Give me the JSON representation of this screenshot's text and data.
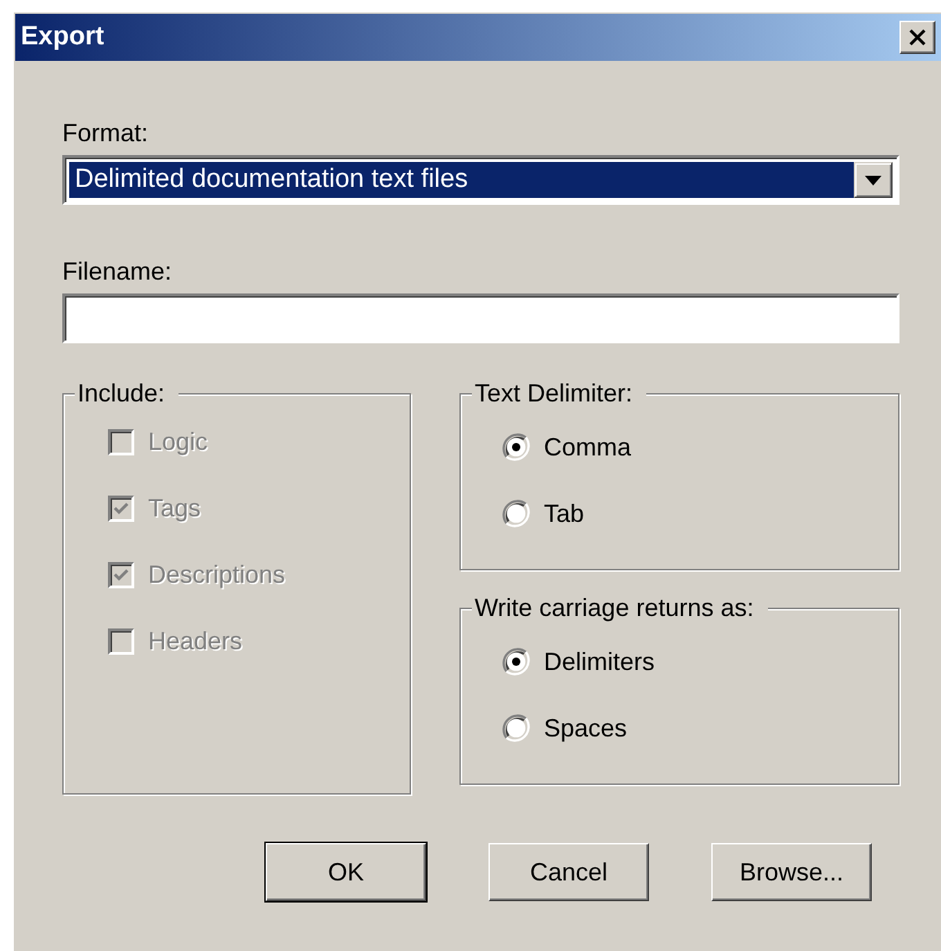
{
  "window": {
    "title": "Export"
  },
  "format": {
    "label": "Format:",
    "value": "Delimited documentation text files",
    "focused": true
  },
  "filename": {
    "label": "Filename:"
  },
  "include": {
    "title": "Include:",
    "items": [
      {
        "label": "Logic",
        "checked": false,
        "disabled": true
      },
      {
        "label": "Tags",
        "checked": true,
        "disabled": true
      },
      {
        "label": "Descriptions",
        "checked": true,
        "disabled": true
      },
      {
        "label": "Headers",
        "checked": false,
        "disabled": true
      }
    ]
  },
  "text_delimiter": {
    "title": "Text Delimiter:",
    "options": [
      {
        "label": "Comma",
        "selected": true
      },
      {
        "label": "Tab",
        "selected": false
      }
    ]
  },
  "carriage_returns": {
    "title": "Write carriage returns as:",
    "options": [
      {
        "label": "Delimiters",
        "selected": true
      },
      {
        "label": "Spaces",
        "selected": false
      }
    ]
  },
  "buttons": [
    {
      "label": "OK",
      "default": true
    },
    {
      "label": "Cancel",
      "default": false
    },
    {
      "label": "Browse...",
      "default": false
    }
  ]
}
